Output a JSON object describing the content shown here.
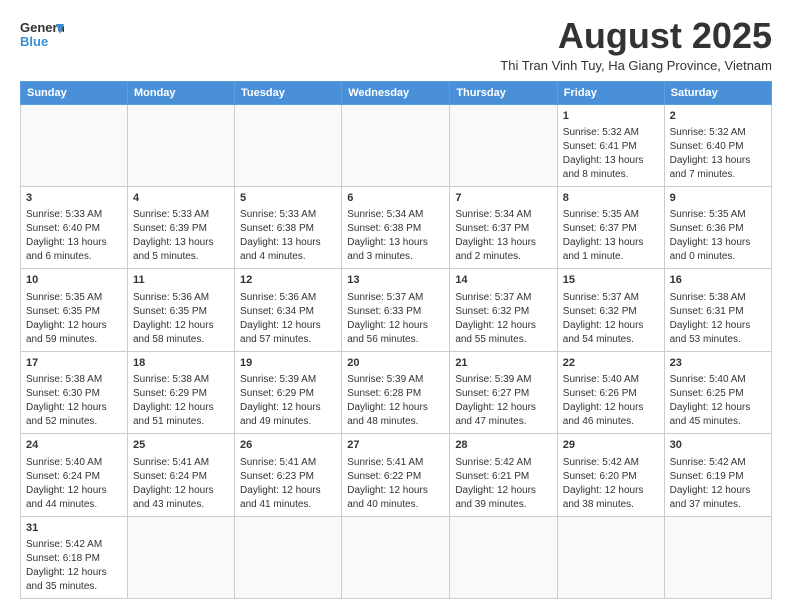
{
  "logo": {
    "general": "General",
    "blue": "Blue"
  },
  "header": {
    "month_year": "August 2025",
    "location": "Thi Tran Vinh Tuy, Ha Giang Province, Vietnam"
  },
  "days_of_week": [
    "Sunday",
    "Monday",
    "Tuesday",
    "Wednesday",
    "Thursday",
    "Friday",
    "Saturday"
  ],
  "weeks": [
    [
      {
        "day": "",
        "content": ""
      },
      {
        "day": "",
        "content": ""
      },
      {
        "day": "",
        "content": ""
      },
      {
        "day": "",
        "content": ""
      },
      {
        "day": "",
        "content": ""
      },
      {
        "day": "1",
        "content": "Sunrise: 5:32 AM\nSunset: 6:41 PM\nDaylight: 13 hours\nand 8 minutes."
      },
      {
        "day": "2",
        "content": "Sunrise: 5:32 AM\nSunset: 6:40 PM\nDaylight: 13 hours\nand 7 minutes."
      }
    ],
    [
      {
        "day": "3",
        "content": "Sunrise: 5:33 AM\nSunset: 6:40 PM\nDaylight: 13 hours\nand 6 minutes."
      },
      {
        "day": "4",
        "content": "Sunrise: 5:33 AM\nSunset: 6:39 PM\nDaylight: 13 hours\nand 5 minutes."
      },
      {
        "day": "5",
        "content": "Sunrise: 5:33 AM\nSunset: 6:38 PM\nDaylight: 13 hours\nand 4 minutes."
      },
      {
        "day": "6",
        "content": "Sunrise: 5:34 AM\nSunset: 6:38 PM\nDaylight: 13 hours\nand 3 minutes."
      },
      {
        "day": "7",
        "content": "Sunrise: 5:34 AM\nSunset: 6:37 PM\nDaylight: 13 hours\nand 2 minutes."
      },
      {
        "day": "8",
        "content": "Sunrise: 5:35 AM\nSunset: 6:37 PM\nDaylight: 13 hours\nand 1 minute."
      },
      {
        "day": "9",
        "content": "Sunrise: 5:35 AM\nSunset: 6:36 PM\nDaylight: 13 hours\nand 0 minutes."
      }
    ],
    [
      {
        "day": "10",
        "content": "Sunrise: 5:35 AM\nSunset: 6:35 PM\nDaylight: 12 hours\nand 59 minutes."
      },
      {
        "day": "11",
        "content": "Sunrise: 5:36 AM\nSunset: 6:35 PM\nDaylight: 12 hours\nand 58 minutes."
      },
      {
        "day": "12",
        "content": "Sunrise: 5:36 AM\nSunset: 6:34 PM\nDaylight: 12 hours\nand 57 minutes."
      },
      {
        "day": "13",
        "content": "Sunrise: 5:37 AM\nSunset: 6:33 PM\nDaylight: 12 hours\nand 56 minutes."
      },
      {
        "day": "14",
        "content": "Sunrise: 5:37 AM\nSunset: 6:32 PM\nDaylight: 12 hours\nand 55 minutes."
      },
      {
        "day": "15",
        "content": "Sunrise: 5:37 AM\nSunset: 6:32 PM\nDaylight: 12 hours\nand 54 minutes."
      },
      {
        "day": "16",
        "content": "Sunrise: 5:38 AM\nSunset: 6:31 PM\nDaylight: 12 hours\nand 53 minutes."
      }
    ],
    [
      {
        "day": "17",
        "content": "Sunrise: 5:38 AM\nSunset: 6:30 PM\nDaylight: 12 hours\nand 52 minutes."
      },
      {
        "day": "18",
        "content": "Sunrise: 5:38 AM\nSunset: 6:29 PM\nDaylight: 12 hours\nand 51 minutes."
      },
      {
        "day": "19",
        "content": "Sunrise: 5:39 AM\nSunset: 6:29 PM\nDaylight: 12 hours\nand 49 minutes."
      },
      {
        "day": "20",
        "content": "Sunrise: 5:39 AM\nSunset: 6:28 PM\nDaylight: 12 hours\nand 48 minutes."
      },
      {
        "day": "21",
        "content": "Sunrise: 5:39 AM\nSunset: 6:27 PM\nDaylight: 12 hours\nand 47 minutes."
      },
      {
        "day": "22",
        "content": "Sunrise: 5:40 AM\nSunset: 6:26 PM\nDaylight: 12 hours\nand 46 minutes."
      },
      {
        "day": "23",
        "content": "Sunrise: 5:40 AM\nSunset: 6:25 PM\nDaylight: 12 hours\nand 45 minutes."
      }
    ],
    [
      {
        "day": "24",
        "content": "Sunrise: 5:40 AM\nSunset: 6:24 PM\nDaylight: 12 hours\nand 44 minutes."
      },
      {
        "day": "25",
        "content": "Sunrise: 5:41 AM\nSunset: 6:24 PM\nDaylight: 12 hours\nand 43 minutes."
      },
      {
        "day": "26",
        "content": "Sunrise: 5:41 AM\nSunset: 6:23 PM\nDaylight: 12 hours\nand 41 minutes."
      },
      {
        "day": "27",
        "content": "Sunrise: 5:41 AM\nSunset: 6:22 PM\nDaylight: 12 hours\nand 40 minutes."
      },
      {
        "day": "28",
        "content": "Sunrise: 5:42 AM\nSunset: 6:21 PM\nDaylight: 12 hours\nand 39 minutes."
      },
      {
        "day": "29",
        "content": "Sunrise: 5:42 AM\nSunset: 6:20 PM\nDaylight: 12 hours\nand 38 minutes."
      },
      {
        "day": "30",
        "content": "Sunrise: 5:42 AM\nSunset: 6:19 PM\nDaylight: 12 hours\nand 37 minutes."
      }
    ],
    [
      {
        "day": "31",
        "content": "Sunrise: 5:42 AM\nSunset: 6:18 PM\nDaylight: 12 hours\nand 35 minutes."
      },
      {
        "day": "",
        "content": ""
      },
      {
        "day": "",
        "content": ""
      },
      {
        "day": "",
        "content": ""
      },
      {
        "day": "",
        "content": ""
      },
      {
        "day": "",
        "content": ""
      },
      {
        "day": "",
        "content": ""
      }
    ]
  ]
}
